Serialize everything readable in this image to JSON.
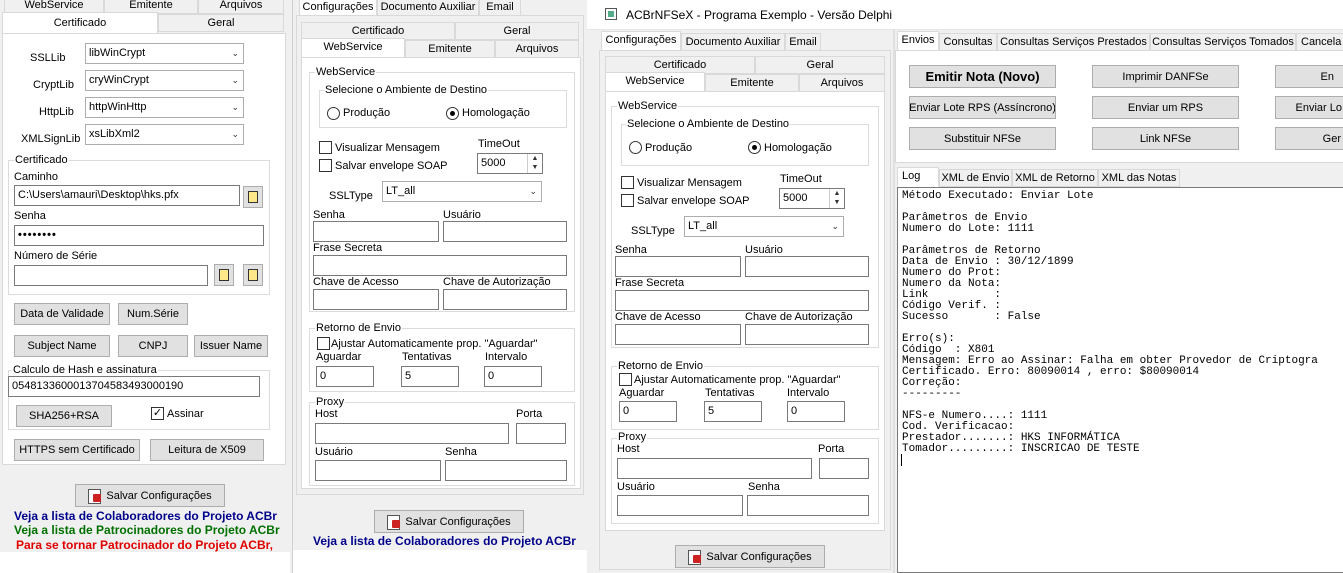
{
  "window": {
    "title": "ACBrNFSeX - Programa Exemplo - Versão Delphi",
    "controls": [
      "—",
      "☐",
      "✕"
    ]
  },
  "panel1": {
    "tabs_top": [
      "WebService",
      "Emitente",
      "Arquivos"
    ],
    "tabs_second": [
      "Certificado",
      "Geral"
    ],
    "ssllib_label": "SSLLib",
    "ssllib_value": "libWinCrypt",
    "cryptlib_label": "CryptLib",
    "cryptlib_value": "cryWinCrypt",
    "httplib_label": "HttpLib",
    "httplib_value": "httpWinHttp",
    "xmlsignlib_label": "XMLSignLib",
    "xmlsignlib_value": "xsLibXml2",
    "certificado_group": "Certificado",
    "caminho_label": "Caminho",
    "caminho_value": "C:\\Users\\amauri\\Desktop\\hks.pfx",
    "senha_label": "Senha",
    "senha_value": "••••••••",
    "numserie_label": "Número de Série",
    "numserie_value": "",
    "btn_data_validade": "Data de Validade",
    "btn_num_serie": "Num.Série",
    "btn_subject_name": "Subject Name",
    "btn_cnpj": "CNPJ",
    "btn_issuer_name": "Issuer Name",
    "hash_label": "Calculo de Hash e assinatura",
    "hash_value": "05481336000137045834930001​90",
    "btn_sha256": "SHA256+RSA",
    "assinar_label": "Assinar",
    "btn_https": "HTTPS sem Certificado",
    "btn_leitura": "Leitura de X509",
    "btn_salvar": "Salvar Configurações",
    "link_colab": "Veja a lista de Colaboradores do Projeto ACBr",
    "link_patro": "Veja a lista de Patrocinadores do Projeto ACBr",
    "link_tornar": "Para se tornar Patrocinador do Projeto ACBr,",
    "colors": {
      "colab": "#00008b",
      "patro": "#007000",
      "tornar": "#e00000"
    }
  },
  "panel2": {
    "tabs_main": [
      "Configurações",
      "Documento Auxiliar",
      "Email"
    ],
    "tabs_row1": [
      "Certificado",
      "Geral"
    ],
    "tabs_row2": [
      "WebService",
      "Emitente",
      "Arquivos"
    ],
    "webservice_group": "WebService",
    "ambiente_group": "Selecione o Ambiente de Destino",
    "producao": "Produção",
    "homologacao": "Homologação",
    "visualizar": "Visualizar Mensagem",
    "salvar_envelope": "Salvar envelope SOAP",
    "timeout_label": "TimeOut",
    "timeout_value": "5000",
    "ssltype_label": "SSLType",
    "ssltype_value": "LT_all",
    "senha_label": "Senha",
    "usuario_label": "Usuário",
    "frase_label": "Frase Secreta",
    "chave_acesso_label": "Chave de Acesso",
    "chave_autorizacao_label": "Chave de Autorização",
    "retorno_group": "Retorno de Envio",
    "ajustar_label": "Ajustar Automaticamente prop. \"Aguardar\"",
    "aguardar_label": "Aguardar",
    "aguardar_value": "0",
    "tentativas_label": "Tentativas",
    "tentativas_value": "5",
    "intervalo_label": "Intervalo",
    "intervalo_value": "0",
    "proxy_group": "Proxy",
    "host_label": "Host",
    "porta_label": "Porta",
    "proxy_usuario_label": "Usuário",
    "proxy_senha_label": "Senha",
    "btn_salvar": "Salvar Configurações",
    "link_colab": "Veja a lista de Colaboradores do Projeto ACBr"
  },
  "panel3": {
    "tabs_right": [
      "Envios",
      "Consultas",
      "Consultas Serviços Prestados",
      "Consultas Serviços Tomados",
      "Cancela"
    ],
    "btn_emitir": "Emitir Nota (Novo)",
    "btn_imprimir": "Imprimir DANFSe",
    "btn_r1": "En",
    "btn_enviar_lote": "Enviar Lote RPS (Assíncrono)",
    "btn_enviar_um": "Enviar um RPS",
    "btn_r2": "Enviar Lo",
    "btn_substituir": "Substituir NFSe",
    "btn_link": "Link NFSe",
    "btn_r3": "Ger",
    "log_tabs": [
      "Log",
      "XML de Envio",
      "XML de Retorno",
      "XML das Notas"
    ],
    "log_lines": [
      "Método Executado: Enviar Lote",
      "",
      "Parâmetros de Envio",
      "Numero do Lote: 1111",
      "",
      "Parâmetros de Retorno",
      "Data de Envio : 30/12/1899",
      "Numero do Prot:",
      "Numero da Nota:",
      "Link          :",
      "Código Verif. :",
      "Sucesso       : False",
      "",
      "Erro(s):",
      "Código  : X801",
      "Mensagem: Erro ao Assinar: Falha em obter Provedor de Criptogra",
      "Certificado. Erro: 80090014 , erro: $80090014",
      "Correção:",
      "---------",
      "",
      "NFS-e Numero....: 1111",
      "Cod. Verificacao:",
      "Prestador.......: HKS INFORMÁTICA",
      "Tomador.........: INSCRICAO DE TESTE"
    ]
  }
}
